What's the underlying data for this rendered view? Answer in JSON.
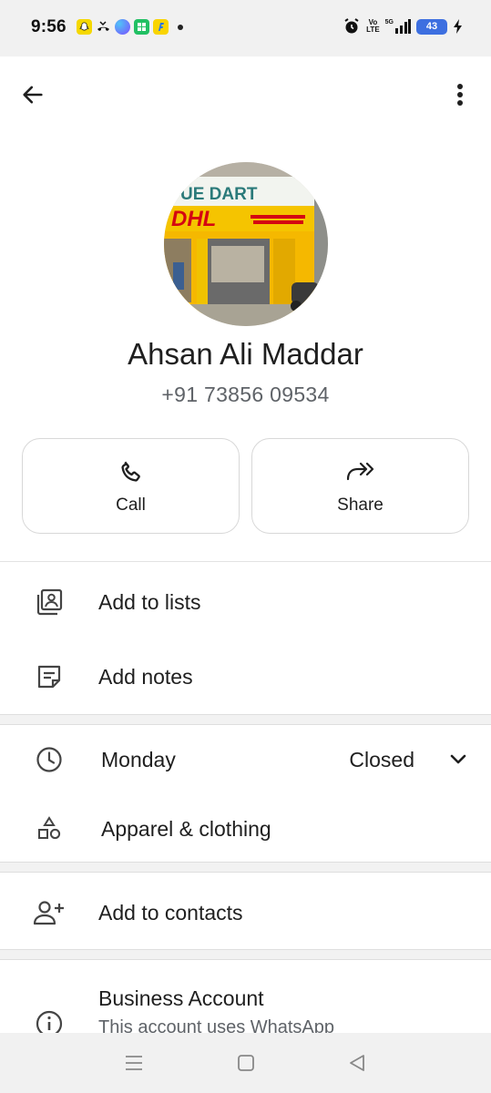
{
  "status_bar": {
    "time": "9:56",
    "battery_level": "43",
    "network_label": "5G",
    "volte_top": "Vo",
    "volte_bottom": "LTE"
  },
  "top_bar": {
    "back_icon": "arrow-back-icon",
    "menu_icon": "more-vert-icon"
  },
  "profile": {
    "name": "Ahsan Ali Maddar",
    "phone": "+91 73856 09534",
    "avatar_sign_top": "UE DART",
    "avatar_sign_brand": "DHL"
  },
  "actions": [
    {
      "label": "Call",
      "icon": "phone-icon"
    },
    {
      "label": "Share",
      "icon": "share-forward-icon"
    }
  ],
  "list_section_1": [
    {
      "label": "Add to lists",
      "icon": "contact-list-icon"
    },
    {
      "label": "Add notes",
      "icon": "notes-icon"
    }
  ],
  "hours": {
    "day": "Monday",
    "status": "Closed",
    "icon": "clock-icon"
  },
  "category": {
    "label": "Apparel & clothing",
    "icon": "category-shapes-icon"
  },
  "contacts": {
    "label": "Add to contacts",
    "icon": "person-add-icon"
  },
  "business": {
    "title": "Business Account",
    "subtitle": "This account uses WhatsApp",
    "icon": "info-icon"
  },
  "colors": {
    "accent_blue": "#3d6fe0",
    "text_primary": "#1f1f1f",
    "text_secondary": "#5f6368"
  }
}
